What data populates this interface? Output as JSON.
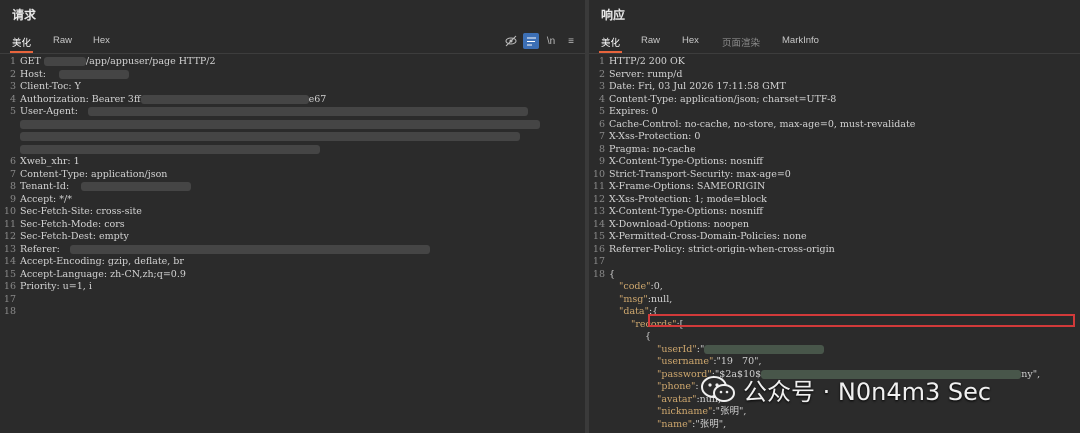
{
  "request": {
    "title": "请求",
    "tabs": [
      "美化",
      "Raw",
      "Hex"
    ],
    "toolbar_icons": [
      "eye-off-icon",
      "wrap-lines-icon",
      "newline-icon",
      "menu-icon"
    ],
    "lines": [
      {
        "n": "1",
        "t": "GET ",
        "b": "",
        "rest": "/app/appuser/page HTTP/2"
      },
      {
        "n": "2",
        "t": "Host: "
      },
      {
        "n": "3",
        "t": "Client-Toc: Y"
      },
      {
        "n": "4",
        "t": "Authorization: Bearer 3ff",
        "tail": "e67"
      },
      {
        "n": "5",
        "t": "User-Agent:"
      },
      {
        "n": "6",
        "t": "Xweb_xhr: 1"
      },
      {
        "n": "7",
        "t": "Content-Type: application/json"
      },
      {
        "n": "8",
        "t": "Tenant-Id:"
      },
      {
        "n": "9",
        "t": "Accept: */*"
      },
      {
        "n": "10",
        "t": "Sec-Fetch-Site: cross-site"
      },
      {
        "n": "11",
        "t": "Sec-Fetch-Mode: cors"
      },
      {
        "n": "12",
        "t": "Sec-Fetch-Dest: empty"
      },
      {
        "n": "13",
        "t": "Referer:"
      },
      {
        "n": "14",
        "t": "Accept-Encoding: gzip, deflate, br"
      },
      {
        "n": "15",
        "t": "Accept-Language: zh-CN,zh;q=0.9"
      },
      {
        "n": "16",
        "t": "Priority: u=1, i"
      },
      {
        "n": "17",
        "t": ""
      },
      {
        "n": "18",
        "t": ""
      }
    ]
  },
  "response": {
    "title": "响应",
    "tabs": [
      "美化",
      "Raw",
      "Hex",
      "页面渲染",
      "MarkInfo"
    ],
    "lines": [
      {
        "n": "1",
        "t": "HTTP/2 200 OK"
      },
      {
        "n": "2",
        "t": "Server: rump/d"
      },
      {
        "n": "3",
        "t": "Date: Fri, 03 Jul 2026 17:11:58 GMT"
      },
      {
        "n": "4",
        "t": "Content-Type: application/json; charset=UTF-8"
      },
      {
        "n": "5",
        "t": "Expires: 0"
      },
      {
        "n": "6",
        "t": "Cache-Control: no-cache, no-store, max-age=0, must-revalidate"
      },
      {
        "n": "7",
        "t": "X-Xss-Protection: 0"
      },
      {
        "n": "8",
        "t": "Pragma: no-cache"
      },
      {
        "n": "9",
        "t": "X-Content-Type-Options: nosniff"
      },
      {
        "n": "10",
        "t": "Strict-Transport-Security: max-age=0"
      },
      {
        "n": "11",
        "t": "X-Frame-Options: SAMEORIGIN"
      },
      {
        "n": "12",
        "t": "X-Xss-Protection: 1; mode=block"
      },
      {
        "n": "13",
        "t": "X-Content-Type-Options: nosniff"
      },
      {
        "n": "14",
        "t": "X-Download-Options: noopen"
      },
      {
        "n": "15",
        "t": "X-Permitted-Cross-Domain-Policies: none"
      },
      {
        "n": "16",
        "t": "Referrer-Policy: strict-origin-when-cross-origin"
      },
      {
        "n": "17",
        "t": ""
      },
      {
        "n": "18",
        "t": "{"
      }
    ],
    "json_lines": [
      {
        "indent": 1,
        "key": "\"code\"",
        "sep": ":",
        "val": "0,"
      },
      {
        "indent": 1,
        "key": "\"msg\"",
        "sep": ":",
        "val": "null,"
      },
      {
        "indent": 1,
        "key": "\"data\"",
        "sep": ":",
        "val": "{"
      },
      {
        "indent": 2,
        "key": "\"records\"",
        "sep": ":",
        "val": "["
      },
      {
        "indent": 3,
        "key": "",
        "sep": "",
        "val": "{"
      },
      {
        "indent": 4,
        "key": "\"userId\"",
        "sep": ":",
        "val": "\""
      },
      {
        "indent": 4,
        "key": "\"username\"",
        "sep": ":",
        "val": "\"19   70\","
      },
      {
        "indent": 4,
        "key": "\"password\"",
        "sep": ":",
        "val": "\"$2a$10$",
        "tail": "ny\","
      },
      {
        "indent": 4,
        "key": "\"phone\"",
        "sep": ":",
        "val": ""
      },
      {
        "indent": 4,
        "key": "\"avatar\"",
        "sep": ":",
        "val": "null,"
      },
      {
        "indent": 4,
        "key": "\"nickname\"",
        "sep": ":",
        "val": "\"张明\","
      },
      {
        "indent": 4,
        "key": "\"name\"",
        "sep": ":",
        "val": "\"张明\","
      }
    ]
  },
  "watermark": {
    "text": "公众号 · N0n4m3 Sec"
  }
}
